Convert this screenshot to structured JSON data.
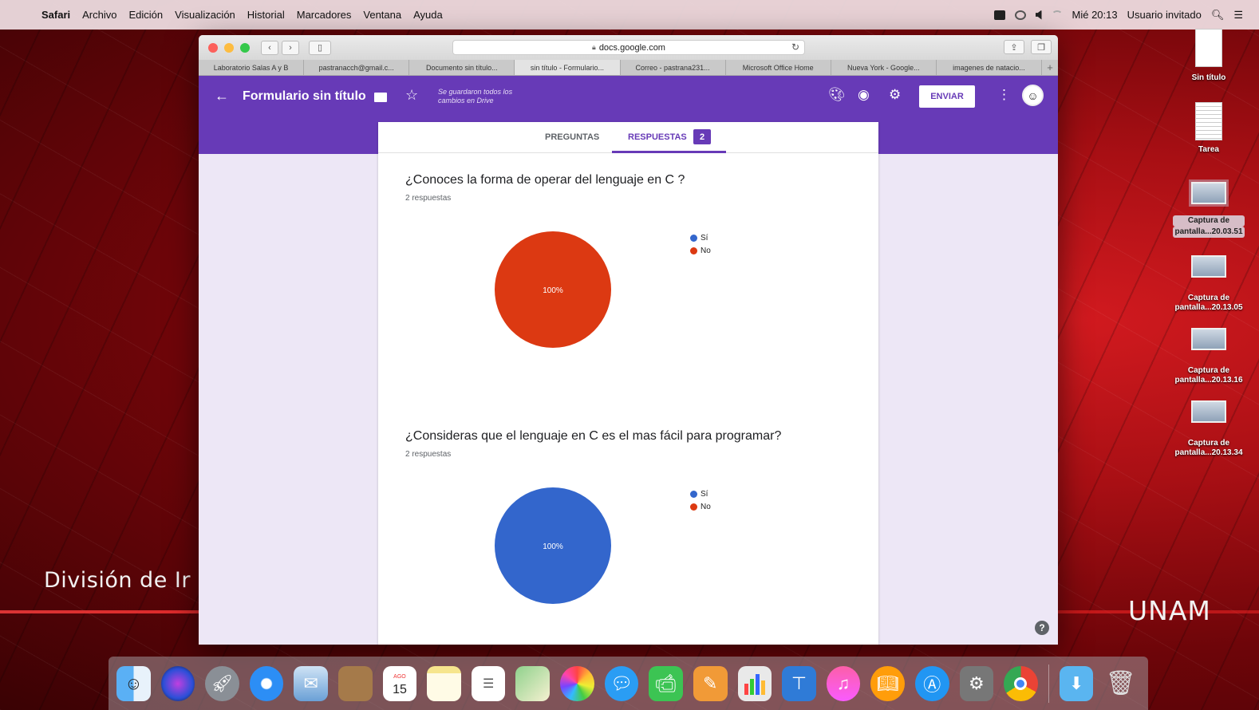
{
  "menubar": {
    "app": "Safari",
    "items": [
      "Archivo",
      "Edición",
      "Visualización",
      "Historial",
      "Marcadores",
      "Ventana",
      "Ayuda"
    ],
    "clock": "Mié 20:13",
    "user": "Usuario invitado"
  },
  "desktop": {
    "left_text": "División de Ir",
    "right_text": "UNAM",
    "icons": [
      {
        "label1": "Sin título",
        "label2": ""
      },
      {
        "label1": "Tarea",
        "label2": ""
      },
      {
        "label1": "Captura de",
        "label2": "pantalla...20.03.51"
      },
      {
        "label1": "Captura de",
        "label2": "pantalla...20.13.05"
      },
      {
        "label1": "Captura de",
        "label2": "pantalla...20.13.16"
      },
      {
        "label1": "Captura de",
        "label2": "pantalla...20.13.34"
      }
    ]
  },
  "browser": {
    "url": "docs.google.com",
    "tabs": [
      "Laboratorio Salas A y B",
      "pastranacch@gmail.c...",
      "Documento sin título...",
      "sin título - Formulario...",
      "Correo - pastrana231...",
      "Microsoft Office Home",
      "Nueva York - Google...",
      "imagenes de natacio..."
    ],
    "active_tab_index": 3
  },
  "form": {
    "title": "Formulario sin título",
    "saved_status": "Se guardaron todos los cambios en Drive",
    "send_label": "ENVIAR",
    "tab_questions": "PREGUNTAS",
    "tab_responses": "RESPUESTAS",
    "responses_count": "2",
    "questions": [
      {
        "title": "¿Conoces la forma de operar del lenguaje en C ?",
        "count": "2 respuestas",
        "chart_data": {
          "type": "pie",
          "categories": [
            "Sí",
            "No"
          ],
          "values": [
            0,
            100
          ],
          "colors": [
            "#3366cc",
            "#dc3912"
          ],
          "slice_label": "100%"
        }
      },
      {
        "title": "¿Consideras que el lenguaje en C es el mas fácil para programar?",
        "count": "2 respuestas",
        "chart_data": {
          "type": "pie",
          "categories": [
            "Sí",
            "No"
          ],
          "values": [
            100,
            0
          ],
          "colors": [
            "#3366cc",
            "#dc3912"
          ],
          "slice_label": "100%"
        }
      }
    ]
  },
  "dock": {
    "apps": [
      "finder-icon",
      "siri-icon",
      "launchpad-icon",
      "safari-icon",
      "mail-icon",
      "contacts-icon",
      "calendar-icon",
      "notes-icon",
      "reminders-icon",
      "maps-icon",
      "photos-icon",
      "messages-icon",
      "facetime-icon",
      "pages-icon",
      "numbers-icon",
      "keynote-icon",
      "itunes-icon",
      "ibooks-icon",
      "appstore-icon",
      "system-preferences-icon",
      "chrome-icon"
    ],
    "calendar_month": "AGO",
    "calendar_day": "15"
  }
}
